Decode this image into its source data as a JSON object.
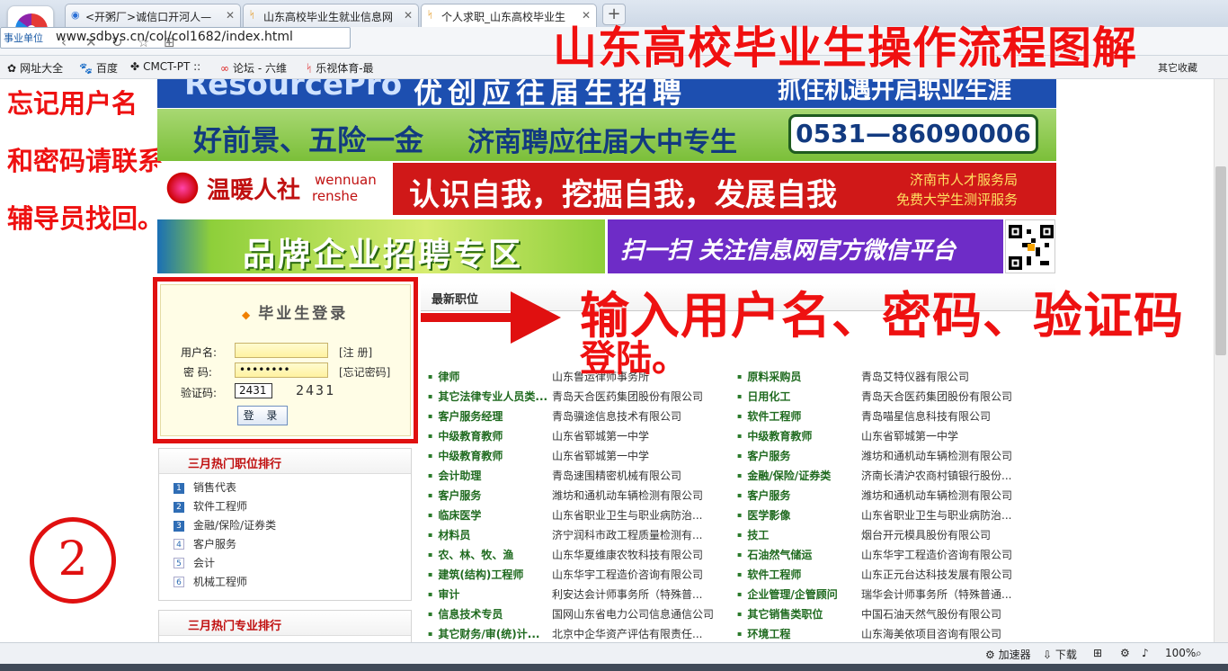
{
  "browser": {
    "tabs": [
      {
        "label": "<开粥厂>诚信口开河人—"
      },
      {
        "label": "山东高校毕业生就业信息网"
      },
      {
        "label": "个人求职_山东高校毕业生"
      }
    ],
    "new_tab": "+",
    "url_tag": "事业单位",
    "url": "www.sdbys.cn/col/col1682/index.html",
    "search_partial": "百度",
    "bookmarks": [
      {
        "icon": "✿",
        "label": "网址大全"
      },
      {
        "icon": "🐾",
        "label": "百度"
      },
      {
        "icon": "✤",
        "label": "CMCT-PT ::"
      },
      {
        "icon": "∞",
        "label": "论坛 - 六维"
      },
      {
        "icon": "ᛋ",
        "label": "乐视体育-最"
      }
    ],
    "other_bookmarks": "其它收藏"
  },
  "overlay": {
    "title": "山东高校毕业生操作流程图解",
    "left_note": [
      "忘记用户名",
      "和密码请联系",
      "辅导员找回。"
    ],
    "instruction_line1": "输入用户名、密码、验证码",
    "instruction_line2": "登陆。",
    "step_number": "2"
  },
  "banners": {
    "top_partial_logo": "ResourcePro",
    "top_partial_text": "优创应往届生招聘",
    "top_partial_right": "抓住机遇开启职业生涯",
    "b1_left": "好前景、五险一金",
    "b1_mid": "济南聘应往届大中专生",
    "b1_phone": "0531—86090006",
    "b2_cn": "温暖人社",
    "b2_en1": "wennuan",
    "b2_en2": "renshe",
    "b2_main": "认识自我，挖掘自我，发展自我",
    "b2_side1": "济南市人才服务局",
    "b2_side2": "免费大学生测评服务",
    "b3_left": "品牌企业招聘专区",
    "b3_right": "扫一扫  关注信息网官方微信平台"
  },
  "login": {
    "title": "毕业生登录",
    "username_label": "用户名:",
    "username_value": "",
    "register_link": "[注 册]",
    "password_label": "密  码:",
    "password_value": "••••••••",
    "forgot_link": "[忘记密码]",
    "captcha_label": "验证码:",
    "captcha_value": "2431",
    "captcha_image_text": "2431",
    "submit_label": "登 录"
  },
  "hot_jobs": {
    "title": "三月热门职位排行",
    "items": [
      {
        "rank": "1",
        "label": "销售代表"
      },
      {
        "rank": "2",
        "label": "软件工程师"
      },
      {
        "rank": "3",
        "label": "金融/保险/证券类"
      },
      {
        "rank": "4",
        "label": "客户服务"
      },
      {
        "rank": "5",
        "label": "会计"
      },
      {
        "rank": "6",
        "label": "机械工程师"
      }
    ]
  },
  "hot_majors": {
    "title": "三月热门专业排行"
  },
  "latest_jobs": {
    "title": "最新职位",
    "left": [
      {
        "title": "律师",
        "company": "山东鲁运律师事务所"
      },
      {
        "title": "其它法律专业人员类...",
        "company": "青岛天合医药集团股份有限公司"
      },
      {
        "title": "客户服务经理",
        "company": "青岛骥途信息技术有限公司"
      },
      {
        "title": "中级教育教师",
        "company": "山东省郓城第一中学"
      },
      {
        "title": "中级教育教师",
        "company": "山东省郓城第一中学"
      },
      {
        "title": "会计助理",
        "company": "青岛速围精密机械有限公司"
      },
      {
        "title": "客户服务",
        "company": "潍坊和通机动车辆检测有限公司"
      },
      {
        "title": "临床医学",
        "company": "山东省职业卫生与职业病防治..."
      },
      {
        "title": "材料员",
        "company": "济宁润科市政工程质量检测有..."
      },
      {
        "title": "农、林、牧、渔",
        "company": "山东华夏维康农牧科技有限公司"
      },
      {
        "title": "建筑(结构)工程师",
        "company": "山东华宇工程造价咨询有限公司"
      },
      {
        "title": "审计",
        "company": "利安达会计师事务所（特殊普..."
      },
      {
        "title": "信息技术专员",
        "company": "国网山东省电力公司信息通信公司"
      },
      {
        "title": "其它财务/审(统)计...",
        "company": "北京中企华资产评估有限责任..."
      }
    ],
    "right": [
      {
        "title": "原料采购员",
        "company": "青岛艾特仪器有限公司"
      },
      {
        "title": "日用化工",
        "company": "青岛天合医药集团股份有限公司"
      },
      {
        "title": "软件工程师",
        "company": "青岛喵星信息科技有限公司"
      },
      {
        "title": "中级教育教师",
        "company": "山东省郓城第一中学"
      },
      {
        "title": "客户服务",
        "company": "潍坊和通机动车辆检测有限公司"
      },
      {
        "title": "金融/保险/证券类",
        "company": "济南长清沪农商村镇银行股份..."
      },
      {
        "title": "客户服务",
        "company": "潍坊和通机动车辆检测有限公司"
      },
      {
        "title": "医学影像",
        "company": "山东省职业卫生与职业病防治..."
      },
      {
        "title": "技工",
        "company": "烟台开元模具股份有限公司"
      },
      {
        "title": "石油然气储运",
        "company": "山东华宇工程造价咨询有限公司"
      },
      {
        "title": "软件工程师",
        "company": "山东正元台达科技发展有限公司"
      },
      {
        "title": "企业管理/企管顾问",
        "company": "瑞华会计师事务所（特殊普通..."
      },
      {
        "title": "其它销售类职位",
        "company": "中国石油天然气股份有限公司"
      },
      {
        "title": "环境工程",
        "company": "山东海美依项目咨询有限公司"
      }
    ]
  },
  "statusbar": {
    "accelerator": "加速器",
    "download": "下载",
    "zoom": "100%"
  },
  "colors": {
    "accent_red": "#e01010",
    "job_green": "#1f6a1f",
    "hot_red": "#c01010"
  }
}
